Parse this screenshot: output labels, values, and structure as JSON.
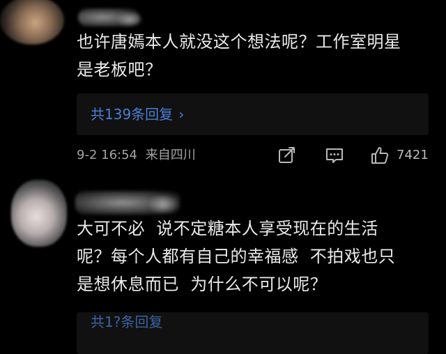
{
  "comments": [
    {
      "text_line1": "也许唐嫣本人就没这个想法呢？工作室明星",
      "text_line2": "是老板吧？",
      "replies_label": "共139条回复",
      "timestamp": "9-2 16:54",
      "location": "来自四川",
      "like_count": "7421"
    },
    {
      "text_line1": "大可不必  说不定糖本人享受现在的生活",
      "text_line2": "呢？每个人都有自己的幸福感  不拍戏也只",
      "text_line3": "是想休息而已  为什么不可以呢？",
      "replies_label": "共1?条回复"
    }
  ],
  "icons": {
    "share": "share-icon",
    "comment": "comment-icon",
    "like": "thumbs-up-icon",
    "chevron": "chevron-right-icon"
  },
  "colors": {
    "background": "#000000",
    "link": "#4a7fd6",
    "meta": "#a4a4a4",
    "text": "#eaeaea"
  }
}
